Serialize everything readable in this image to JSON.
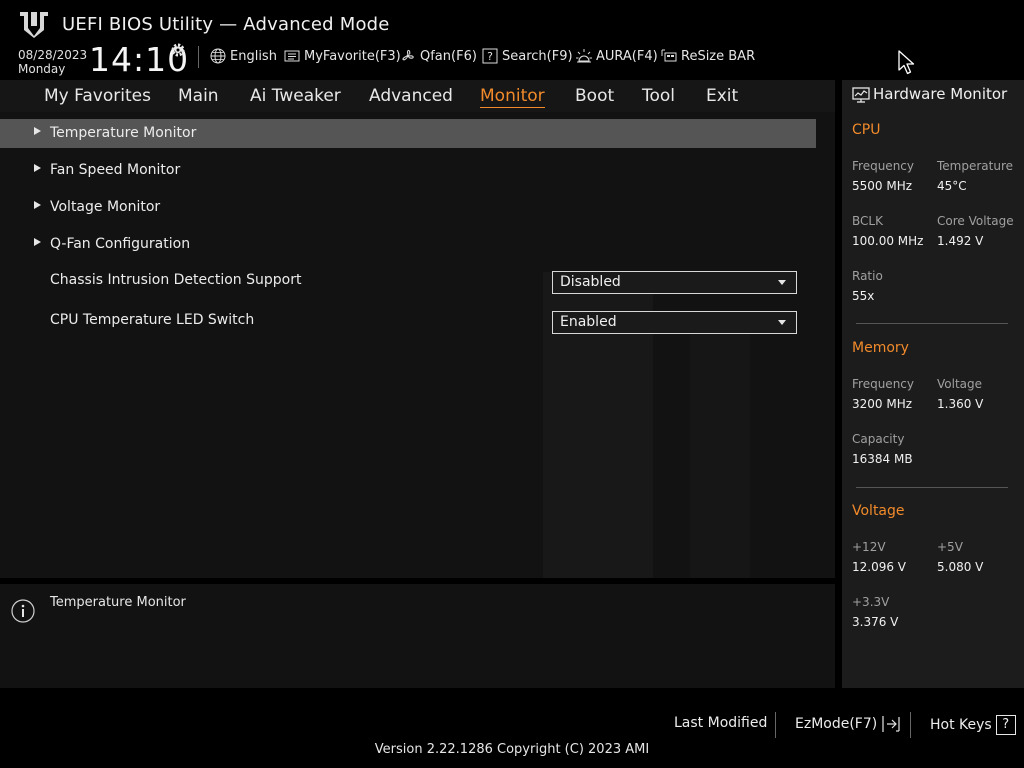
{
  "header": {
    "title": "UEFI BIOS Utility — Advanced Mode",
    "date": "08/28/2023",
    "day": "Monday",
    "time": "14:10",
    "tools": [
      {
        "label": "English",
        "icon": "globe-icon"
      },
      {
        "label": "MyFavorite(F3)",
        "icon": "favorite-list-icon"
      },
      {
        "label": "Qfan(F6)",
        "icon": "fan-icon"
      },
      {
        "label": "Search(F9)",
        "icon": "search-help-icon"
      },
      {
        "label": "AURA(F4)",
        "icon": "aura-light-icon"
      },
      {
        "label": "ReSize BAR",
        "icon": "resize-bar-icon"
      }
    ]
  },
  "nav": {
    "tabs": [
      "My Favorites",
      "Main",
      "Ai Tweaker",
      "Advanced",
      "Monitor",
      "Boot",
      "Tool",
      "Exit"
    ],
    "active": "Monitor"
  },
  "menu": {
    "items": [
      {
        "label": "Temperature Monitor",
        "selected": true
      },
      {
        "label": "Fan Speed Monitor"
      },
      {
        "label": "Voltage Monitor"
      },
      {
        "label": "Q-Fan Configuration"
      }
    ],
    "settings": [
      {
        "label": "Chassis Intrusion Detection Support",
        "value": "Disabled"
      },
      {
        "label": "CPU Temperature LED Switch",
        "value": "Enabled"
      }
    ]
  },
  "help": {
    "text": "Temperature Monitor"
  },
  "hardware_monitor": {
    "title": "Hardware Monitor",
    "cpu": {
      "title": "CPU",
      "frequency_label": "Frequency",
      "frequency": "5500 MHz",
      "temperature_label": "Temperature",
      "temperature": "45°C",
      "bclk_label": "BCLK",
      "bclk": "100.00 MHz",
      "core_voltage_label": "Core Voltage",
      "core_voltage": "1.492 V",
      "ratio_label": "Ratio",
      "ratio": "55x"
    },
    "memory": {
      "title": "Memory",
      "frequency_label": "Frequency",
      "frequency": "3200 MHz",
      "voltage_label": "Voltage",
      "voltage": "1.360 V",
      "capacity_label": "Capacity",
      "capacity": "16384 MB"
    },
    "voltage": {
      "title": "Voltage",
      "v12_label": "+12V",
      "v12": "12.096 V",
      "v5_label": "+5V",
      "v5": "5.080 V",
      "v33_label": "+3.3V",
      "v33": "3.376 V"
    }
  },
  "footer": {
    "last_modified": "Last Modified",
    "ezmode": "EzMode(F7)",
    "hotkeys": "Hot Keys",
    "hotkeys_glyph": "?",
    "version": "Version 2.22.1286 Copyright (C) 2023 AMI"
  },
  "colors": {
    "accent": "#f08a2a",
    "background": "#121212",
    "selected_row": "#555555"
  }
}
